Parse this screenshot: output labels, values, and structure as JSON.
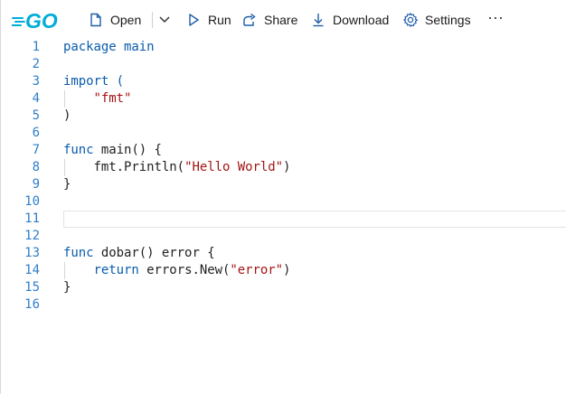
{
  "toolbar": {
    "logo_text": "GO",
    "open_label": "Open",
    "run_label": "Run",
    "share_label": "Share",
    "download_label": "Download",
    "settings_label": "Settings",
    "more_label": "···"
  },
  "editor": {
    "lines": [
      {
        "number": "1",
        "segments": [
          {
            "text": "package main",
            "class": "kw"
          }
        ]
      },
      {
        "number": "2",
        "segments": [
          {
            "text": "",
            "class": ""
          }
        ]
      },
      {
        "number": "3",
        "segments": [
          {
            "text": "import (",
            "class": "kw"
          }
        ]
      },
      {
        "number": "4",
        "segments": [
          {
            "text": "    ",
            "class": ""
          },
          {
            "text": "\"fmt\"",
            "class": "str"
          }
        ]
      },
      {
        "number": "5",
        "segments": [
          {
            "text": ")",
            "class": ""
          }
        ]
      },
      {
        "number": "6",
        "segments": [
          {
            "text": "",
            "class": ""
          }
        ]
      },
      {
        "number": "7",
        "segments": [
          {
            "text": "func",
            "class": "kw"
          },
          {
            "text": " main() {",
            "class": ""
          }
        ]
      },
      {
        "number": "8",
        "segments": [
          {
            "text": "    fmt.Println(",
            "class": ""
          },
          {
            "text": "\"Hello World\"",
            "class": "str"
          },
          {
            "text": ")",
            "class": ""
          }
        ]
      },
      {
        "number": "9",
        "segments": [
          {
            "text": "}",
            "class": ""
          }
        ]
      },
      {
        "number": "10",
        "segments": [
          {
            "text": "",
            "class": ""
          }
        ]
      },
      {
        "number": "11",
        "segments": [
          {
            "text": "",
            "class": ""
          }
        ],
        "current": true
      },
      {
        "number": "12",
        "segments": [
          {
            "text": "",
            "class": ""
          }
        ]
      },
      {
        "number": "13",
        "segments": [
          {
            "text": "func",
            "class": "kw"
          },
          {
            "text": " dobar() error {",
            "class": ""
          }
        ]
      },
      {
        "number": "14",
        "segments": [
          {
            "text": "    ",
            "class": ""
          },
          {
            "text": "return",
            "class": "kw"
          },
          {
            "text": " errors.New(",
            "class": ""
          },
          {
            "text": "\"error\"",
            "class": "str"
          },
          {
            "text": ")",
            "class": ""
          }
        ]
      },
      {
        "number": "15",
        "segments": [
          {
            "text": "}",
            "class": ""
          }
        ]
      },
      {
        "number": "16",
        "segments": [
          {
            "text": "",
            "class": ""
          }
        ]
      }
    ]
  },
  "colors": {
    "keyword": "#0b5cad",
    "string": "#a31515",
    "line_number": "#2f7ec8",
    "go_brand": "#00add8"
  },
  "icons": {
    "logo": "go-logo-icon",
    "open": "file-icon",
    "dropdown": "chevron-down-icon",
    "run": "play-icon",
    "share": "share-icon",
    "download": "download-icon",
    "settings": "gear-icon",
    "more": "more-icon"
  }
}
